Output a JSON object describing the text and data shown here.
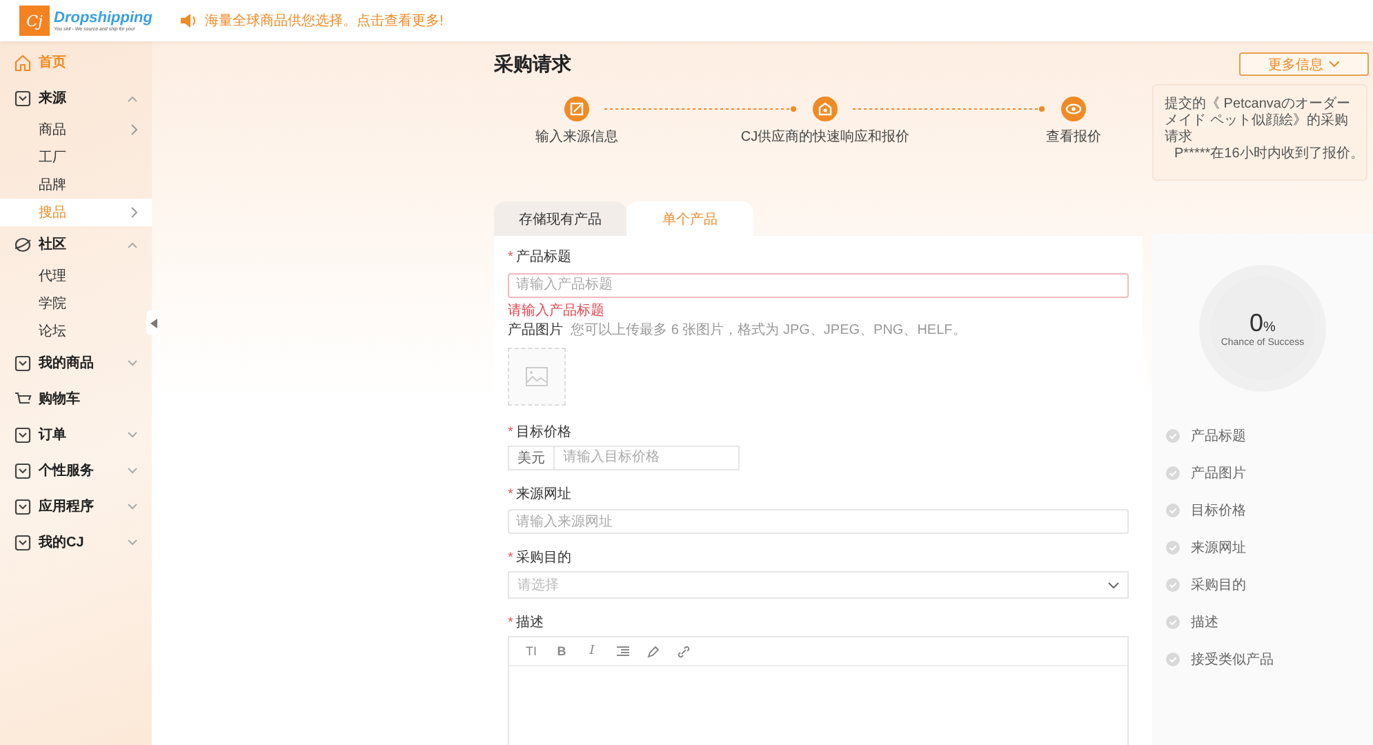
{
  "header": {
    "logo_mark": "Cj",
    "logo_name": "Dropshipping",
    "logo_tagline": "You sell - We source and ship for you!",
    "announcement": "海量全球商品供您选择。点击查看更多!"
  },
  "sidebar": {
    "items": [
      {
        "label": "首页",
        "highlighted": true
      },
      {
        "label": "来源",
        "highlighted": false,
        "expanded": true,
        "children": [
          {
            "label": "商品",
            "selected": false,
            "has_submenu": true
          },
          {
            "label": "工厂",
            "selected": false,
            "has_submenu": false
          },
          {
            "label": "品牌",
            "selected": false,
            "has_submenu": false
          },
          {
            "label": "搜品",
            "selected": true,
            "has_submenu": true
          }
        ]
      },
      {
        "label": "社区",
        "highlighted": false,
        "expanded": true,
        "children": [
          {
            "label": "代理",
            "selected": false,
            "has_submenu": false
          },
          {
            "label": "学院",
            "selected": false,
            "has_submenu": false
          },
          {
            "label": "论坛",
            "selected": false,
            "has_submenu": false
          }
        ]
      },
      {
        "label": "我的商品",
        "highlighted": false,
        "expanded": false
      },
      {
        "label": "购物车",
        "highlighted": false
      },
      {
        "label": "订单",
        "highlighted": false,
        "expanded": false
      },
      {
        "label": "个性服务",
        "highlighted": false,
        "expanded": false
      },
      {
        "label": "应用程序",
        "highlighted": false,
        "expanded": false
      },
      {
        "label": "我的CJ",
        "highlighted": false,
        "expanded": false
      }
    ]
  },
  "page_title": "采购请求",
  "steps": [
    {
      "label": "输入来源信息"
    },
    {
      "label": "CJ供应商的快速响应和报价"
    },
    {
      "label": "查看报价"
    }
  ],
  "tabs": [
    {
      "label": "存储现有产品",
      "selected": false
    },
    {
      "label": "单个产品",
      "selected": true
    }
  ],
  "form": {
    "title_field": {
      "label": "产品标题",
      "required_mark": "*",
      "placeholder": "请输入产品标题",
      "error": "请输入产品标题"
    },
    "images": {
      "label": "产品图片",
      "hint": "您可以上传最多 6 张图片，格式为 JPG、JPEG、PNG、HELF。"
    },
    "price_field": {
      "label": "目标价格",
      "required_mark": "*",
      "prefix": "美元",
      "placeholder": "请输入目标价格"
    },
    "url_field": {
      "label": "来源网址",
      "required_mark": "*",
      "placeholder": "请输入来源网址"
    },
    "purpose_field": {
      "label": "采购目的",
      "required_mark": "*",
      "placeholder": "请选择"
    },
    "description": {
      "label": "描述",
      "required_mark": "*",
      "toolbar": [
        {
          "kind": "heading",
          "label": "TI"
        },
        {
          "kind": "bold",
          "label": "B"
        },
        {
          "kind": "italic",
          "label": "I"
        },
        {
          "kind": "list"
        },
        {
          "kind": "pen"
        },
        {
          "kind": "link"
        }
      ]
    }
  },
  "more_info_button": "更多信息",
  "notice": {
    "text_before_flag": "提交的《 Petcanvaのオーダーメイド ペット似顔絵》的采购请求",
    "text_after_flag": "P*****在16小时内收到了报价。"
  },
  "success": {
    "percent": "0",
    "unit": "%",
    "caption": "Chance of Success",
    "level": 0
  },
  "checklist": [
    {
      "label": "产品标题",
      "checked": false
    },
    {
      "label": "产品图片",
      "checked": false
    },
    {
      "label": "目标价格",
      "checked": false
    },
    {
      "label": "来源网址",
      "checked": false
    },
    {
      "label": "采购目的",
      "checked": false
    },
    {
      "label": "描述",
      "checked": false
    },
    {
      "label": "接受类似产品",
      "checked": false
    }
  ]
}
